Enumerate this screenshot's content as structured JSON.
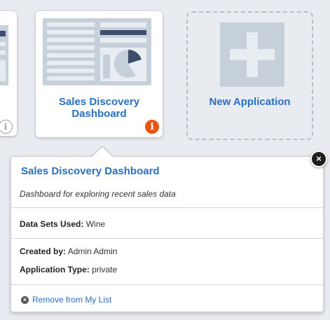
{
  "tiles": {
    "partial_left": {
      "info_icon": "info-icon"
    },
    "main": {
      "title_line1": "Sales Discovery",
      "title_line2": "Dashboard",
      "info_icon": "info-icon",
      "info_glyph": "i",
      "info_color": "#e8550f"
    },
    "new_app": {
      "label": "New Application",
      "plus_icon": "plus-icon"
    }
  },
  "popover": {
    "title": "Sales Discovery Dashboard",
    "description": "Dashboard for exploring recent sales data",
    "data_sets_label": "Data Sets Used:",
    "data_sets_value": " Wine",
    "created_by_label": "Created by:",
    "created_by_value": " Admin Admin",
    "app_type_label": "Application Type:",
    "app_type_value": " private",
    "remove_label": "Remove from My List",
    "close_glyph": "×"
  },
  "colors": {
    "link_blue": "#2a6fc0",
    "info_orange": "#e8550f",
    "thumb_bg": "#c5d0da"
  }
}
